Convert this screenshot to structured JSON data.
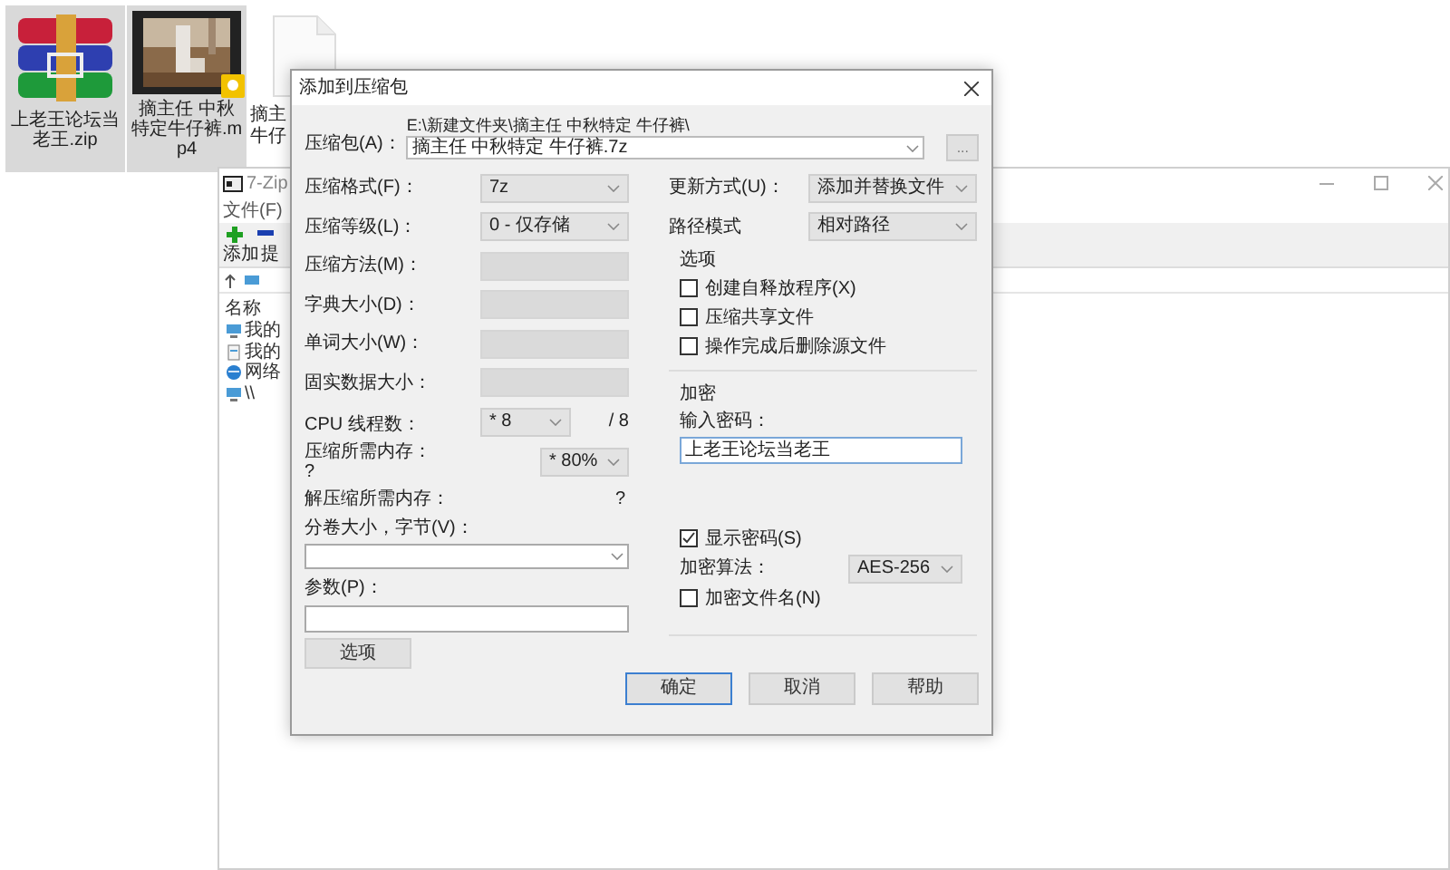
{
  "desktop_icons": [
    {
      "kind": "archive",
      "label": "上老王论坛当老王.zip",
      "selected": true
    },
    {
      "kind": "video",
      "label": "摘主任 中秋特定牛仔裤.mp4",
      "selected": true
    },
    {
      "kind": "file",
      "label": "摘主牛仔",
      "selected": false
    }
  ],
  "sevenzip_window": {
    "title": "7-Zip",
    "menu": [
      "文件(F)"
    ],
    "toolbar": [
      "添加",
      "提"
    ],
    "list_header": "名称",
    "items": [
      {
        "kind": "computer",
        "name": "我的"
      },
      {
        "kind": "documents",
        "name": "我的"
      },
      {
        "kind": "network",
        "name": "网络"
      },
      {
        "kind": "computer",
        "name": "\\\\"
      }
    ]
  },
  "dialog": {
    "title": "添加到压缩包",
    "archive_label": "压缩包(A)：",
    "archive_path": "E:\\新建文件夹\\摘主任 中秋特定 牛仔裤\\",
    "archive_name": "摘主任 中秋特定 牛仔裤.7z",
    "browse_button": "...",
    "left_rows": [
      {
        "kind": "select",
        "label": "压缩格式(F)：",
        "value": "7z",
        "disabled": false
      },
      {
        "kind": "select",
        "label": "压缩等级(L)：",
        "value": "0 - 仅存储",
        "disabled": false
      },
      {
        "kind": "select",
        "label": "压缩方法(M)：",
        "disabled": true
      },
      {
        "kind": "select",
        "label": "字典大小(D)：",
        "disabled": true
      },
      {
        "kind": "select",
        "label": "单词大小(W)：",
        "disabled": true
      },
      {
        "kind": "select",
        "label": "固实数据大小：",
        "disabled": true
      },
      {
        "kind": "cpu",
        "label": "CPU 线程数：",
        "value": "* 8",
        "suffix": "/ 8"
      },
      {
        "kind": "memory",
        "label": "压缩所需内存：",
        "note": "?",
        "value": "* 80%"
      },
      {
        "kind": "info",
        "label": "解压缩所需内存：",
        "value": "?"
      }
    ],
    "split_label": "分卷大小，字节(V)：",
    "params_label": "参数(P)：",
    "options_button": "选项",
    "update_label": "更新方式(U)：",
    "update_value": "添加并替换文件",
    "path_label": "路径模式",
    "path_value": "相对路径",
    "options_group": {
      "title": "选项",
      "checkboxes": [
        {
          "label": "创建自释放程序(X)",
          "checked": false
        },
        {
          "label": "压缩共享文件",
          "checked": false
        },
        {
          "label": "操作完成后删除源文件",
          "checked": false
        }
      ]
    },
    "encryption_group": {
      "title": "加密",
      "password_label": "输入密码：",
      "password": "上老王论坛当老王",
      "show_password": {
        "label": "显示密码(S)",
        "checked": true
      },
      "method_label": "加密算法：",
      "method": "AES-256",
      "encrypt_names": {
        "label": "加密文件名(N)",
        "checked": false
      }
    },
    "buttons": [
      {
        "label": "确定",
        "default": true
      },
      {
        "label": "取消",
        "default": false
      },
      {
        "label": "帮助",
        "default": false
      }
    ]
  }
}
